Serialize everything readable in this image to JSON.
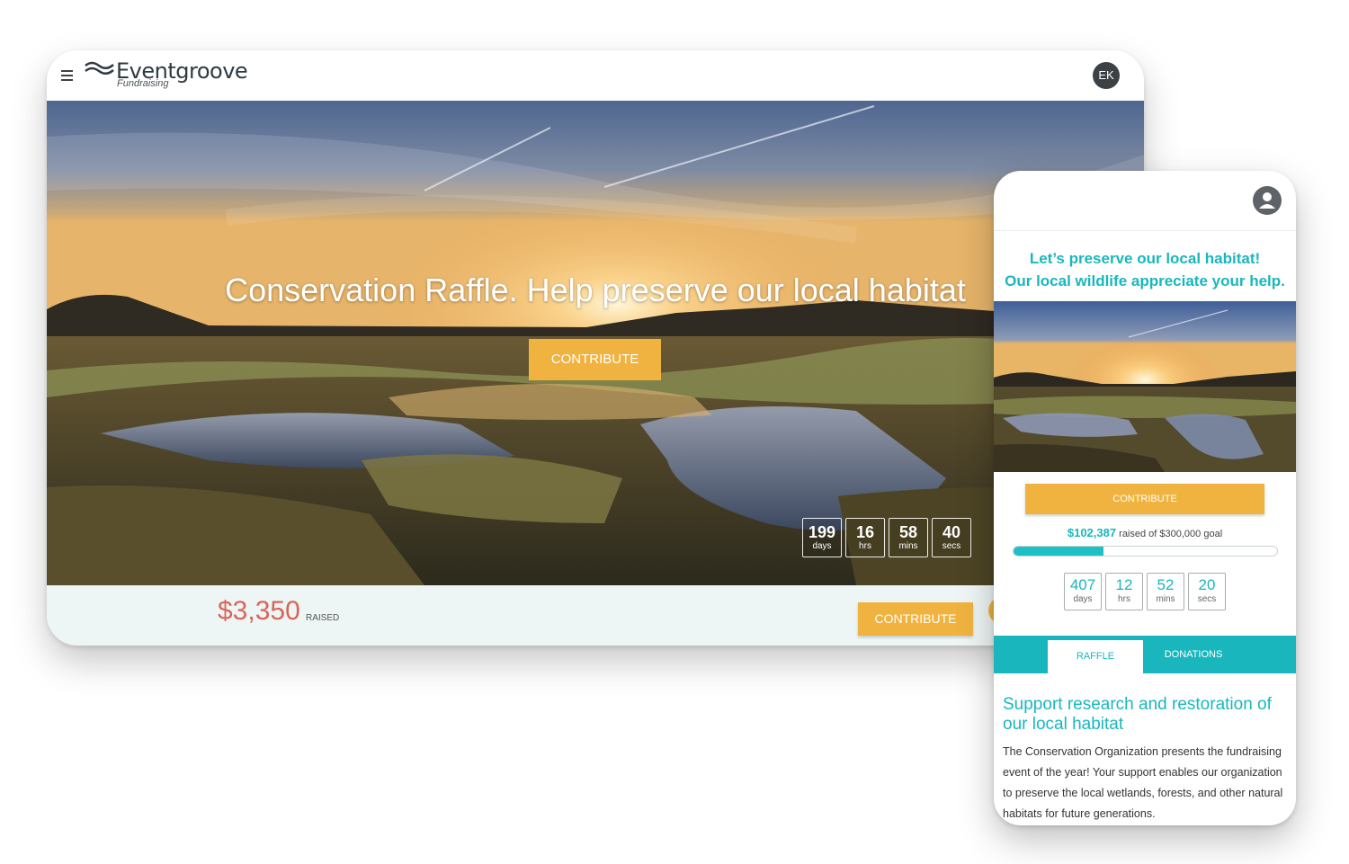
{
  "desktop": {
    "brand": {
      "name": "Eventgroove",
      "subtitle": "Fundraising"
    },
    "user_initials": "EK",
    "hero": {
      "title": "Conservation Raffle. Help preserve our local habitat",
      "button_label": "CONTRIBUTE"
    },
    "countdown": [
      {
        "value": "199",
        "unit": "days"
      },
      {
        "value": "16",
        "unit": "hrs"
      },
      {
        "value": "58",
        "unit": "mins"
      },
      {
        "value": "40",
        "unit": "secs"
      }
    ],
    "footer": {
      "raised_amount": "$3,350",
      "raised_label": "RAISED",
      "button_label": "CONTRIBUTE"
    }
  },
  "mobile": {
    "headline_line1": "Let’s preserve our local habitat!",
    "headline_line2": "Our local wildlife appreciate your help.",
    "button_label": "CONTRIBUTE",
    "raised_amount": "$102,387",
    "raised_text": "raised of $300,000 goal",
    "progress_fraction": 0.34,
    "countdown": [
      {
        "value": "407",
        "unit": "days"
      },
      {
        "value": "12",
        "unit": "hrs"
      },
      {
        "value": "52",
        "unit": "mins"
      },
      {
        "value": "20",
        "unit": "secs"
      }
    ],
    "tabs": [
      {
        "label": "RAFFLE",
        "active": true
      },
      {
        "label": "DONATIONS",
        "active": false
      }
    ],
    "section_title": "Support research and restoration of our local habitat",
    "section_body": "The Conservation Organization presents the fundraising event of the year! Your support enables our organization to preserve the local wetlands, forests, and other natural habitats for future generations."
  },
  "colors": {
    "accent": "#f0b33f",
    "teal": "#19b7bd",
    "raised": "#d9655a"
  }
}
